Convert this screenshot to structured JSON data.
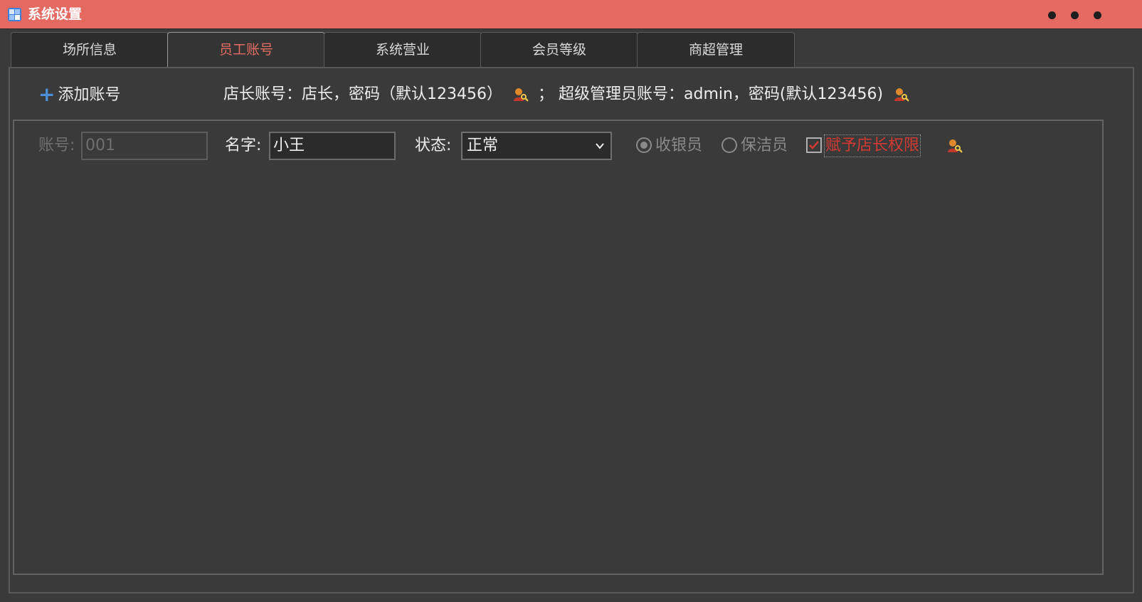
{
  "window": {
    "title": "系统设置",
    "controls": [
      "minimize-dot",
      "maximize-dot",
      "close-dot"
    ]
  },
  "tabs": [
    {
      "label": "场所信息",
      "active": false
    },
    {
      "label": "员工账号",
      "active": true
    },
    {
      "label": "系统营业",
      "active": false
    },
    {
      "label": "会员等级",
      "active": false
    },
    {
      "label": "商超管理",
      "active": false
    }
  ],
  "toolbar": {
    "add_label": "添加账号",
    "add_icon": "plus-icon",
    "manager_info": "店长账号：店长，密码（默认123456）",
    "separator": "；",
    "admin_info": "超级管理员账号：admin，密码(默认123456)",
    "key_icon": "user-key-icon"
  },
  "employee": {
    "account_label": "账号:",
    "account_value": "001",
    "name_label": "名字:",
    "name_value": "小王",
    "status_label": "状态:",
    "status_value": "正常",
    "role_cashier": "收银员",
    "role_cleaner": "保洁员",
    "selected_role": "收银员",
    "grant_label": "赋予店长权限",
    "grant_checked": true
  },
  "colors": {
    "titlebar": "#e46a61",
    "accent": "#e36d62",
    "warning_text": "#d03a32",
    "plus": "#4a8fd8"
  }
}
